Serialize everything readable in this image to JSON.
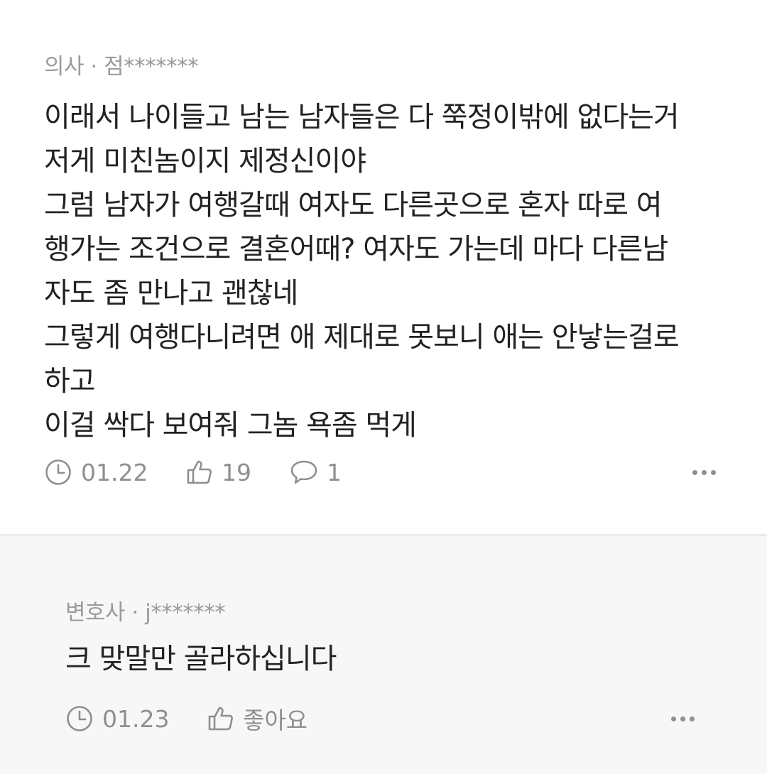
{
  "comment": {
    "job": "의사",
    "separator": "·",
    "author": "점*******",
    "text": "이래서 나이들고 남는 남자들은 다 쭉정이밖에 없다는거\n저게 미친놈이지 제정신이야\n그럼 남자가 여행갈때 여자도 다른곳으로 혼자 따로 여\n행가는 조건으로 결혼어때? 여자도 가는데 마다 다른남\n자도 좀 만나고 괜찮네\n그렇게 여행다니려면 애 제대로 못보니 애는 안낳는걸로\n하고\n이걸 싹다 보여줘 그놈 욕좀 먹게",
    "date": "01.22",
    "likes": "19",
    "replies": "1",
    "icons": [
      "clock-icon",
      "thumbs-up-icon",
      "speech-bubble-icon",
      "more-options-icon"
    ]
  },
  "reply": {
    "job": "변호사",
    "separator": "·",
    "author": "j*******",
    "text": "크 맞말만 골라하십니다",
    "date": "01.23",
    "like_label": "좋아요",
    "icons": [
      "clock-icon",
      "thumbs-up-icon",
      "more-options-icon"
    ]
  },
  "colors": {
    "meta_text": "#9b9b9b",
    "body_text": "#222222",
    "action_text": "#8f8f8f",
    "reply_bg": "#f7f7f7",
    "divider": "#ebebeb"
  }
}
